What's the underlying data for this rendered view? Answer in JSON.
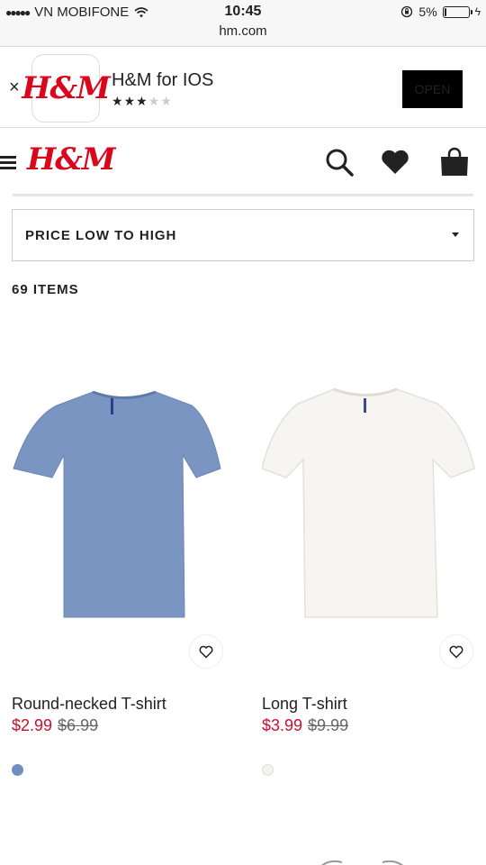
{
  "status": {
    "carrier": "VN MOBIFONE",
    "time": "10:45",
    "url": "hm.com",
    "battery": "5%",
    "battery_level": 0.05
  },
  "banner": {
    "close": "×",
    "logo": "H&M",
    "app_title": "H&M for IOS",
    "rating": 3,
    "rating_max": 5,
    "open_label": "OPEN"
  },
  "header": {
    "logo": "H&M",
    "menu_icon": "hamburger-icon",
    "search_icon": "search-icon",
    "favorites_icon": "heart-icon",
    "bag_icon": "shopping-bag-icon"
  },
  "sort": {
    "selected": "PRICE LOW TO HIGH"
  },
  "items_count": "69 ITEMS",
  "products": [
    {
      "name": "Round-necked T-shirt",
      "price": "$2.99",
      "old_price": "$6.99",
      "color": "#7b95c2",
      "swatch": "#6f8fc0"
    },
    {
      "name": "Long T-shirt",
      "price": "$3.99",
      "old_price": "$9.99",
      "color": "#f6f5f1",
      "swatch": "#f3f3ee"
    }
  ]
}
